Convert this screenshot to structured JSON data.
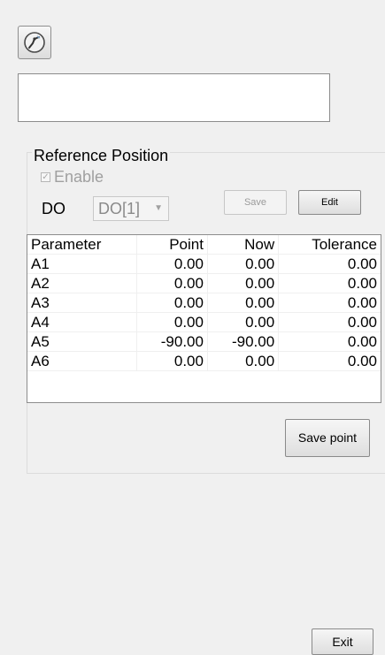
{
  "reference": {
    "title": "Reference Position",
    "enable_label": "Enable",
    "do_label": "DO",
    "do_value": "DO[1]",
    "save_label": "Save",
    "edit_label": "Edit"
  },
  "table": {
    "headers": [
      "Parameter",
      "Point",
      "Now",
      "Tolerance"
    ],
    "rows": [
      [
        "A1",
        "0.00",
        "0.00",
        "0.00"
      ],
      [
        "A2",
        "0.00",
        "0.00",
        "0.00"
      ],
      [
        "A3",
        "0.00",
        "0.00",
        "0.00"
      ],
      [
        "A4",
        "0.00",
        "0.00",
        "0.00"
      ],
      [
        "A5",
        "-90.00",
        "-90.00",
        "0.00"
      ],
      [
        "A6",
        "0.00",
        "0.00",
        "0.00"
      ]
    ]
  },
  "buttons": {
    "save_point": "Save point",
    "exit": "Exit"
  },
  "icons": {
    "tool": "robot-arm-icon",
    "dropdown": "chevron-down-icon"
  }
}
